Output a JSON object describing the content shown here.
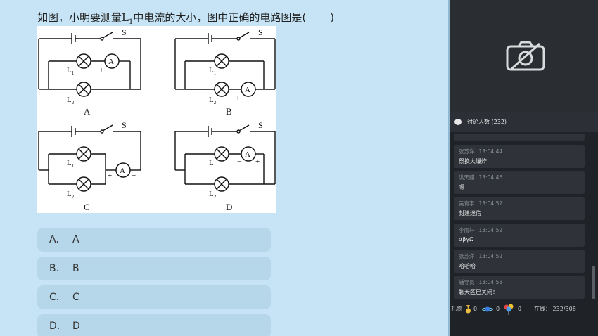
{
  "question": {
    "prefix": "如图，小明要测量",
    "l_symbol": "L",
    "l_sub": "1",
    "suffix": "中电流的大小，图中正确的电路图是(",
    "close_paren": ")"
  },
  "figure": {
    "letters": [
      "A",
      "B",
      "C",
      "D"
    ],
    "switch_label": "S",
    "lamp1": "L",
    "lamp1_sub": "1",
    "lamp2": "L",
    "lamp2_sub": "2",
    "ammeter": "A",
    "plus": "+",
    "minus": "−"
  },
  "options": [
    {
      "letter": "A.",
      "text": "A"
    },
    {
      "letter": "B.",
      "text": "B"
    },
    {
      "letter": "C.",
      "text": "C"
    },
    {
      "letter": "D.",
      "text": "D"
    }
  ],
  "chat": {
    "title": "讨论人数 (232)",
    "messages": [
      {
        "user": "张苏洋",
        "time": "13:04:44",
        "text": "祭换大爆炸"
      },
      {
        "user": "洪天麒",
        "time": "13:04:46",
        "text": "嗯"
      },
      {
        "user": "吴青宇",
        "time": "13:04:52",
        "text": "封建迷信"
      },
      {
        "user": "李雨轩",
        "time": "13:04:52",
        "text": "αβγΩ"
      },
      {
        "user": "张苏洋",
        "time": "13:04:52",
        "text": "哈哈哈"
      },
      {
        "user": "辅导员",
        "time": "13:04:58",
        "text": "聊天区已关闭！"
      }
    ]
  },
  "footer": {
    "gift_label": "礼物",
    "gift_counts": [
      "0",
      "0",
      "0"
    ],
    "online_label": "在线：",
    "online_value": "232/308"
  },
  "colors": {
    "page_bg": "#c6e4f5",
    "option_bg": "#b6d7ea",
    "panel_bg": "#1f2226",
    "message_bg": "#2f3339"
  },
  "icons": [
    "camera-off-icon",
    "chat-bubble-icon",
    "medal-gift-icon",
    "planet-gift-icon",
    "balloon-gift-icon"
  ]
}
